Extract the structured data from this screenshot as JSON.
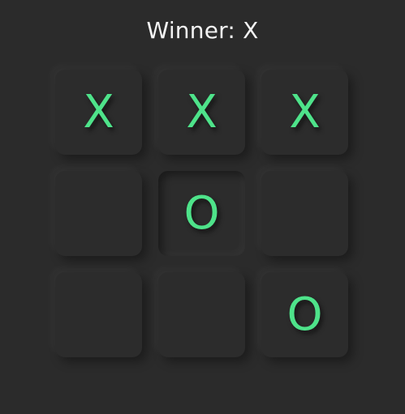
{
  "status": {
    "text": "Winner: X"
  },
  "colors": {
    "background": "#2b2b2b",
    "mark": "#4ee38a",
    "text": "#f3f3f3"
  },
  "board": {
    "cells": [
      {
        "mark": "X",
        "pressed": false
      },
      {
        "mark": "X",
        "pressed": false
      },
      {
        "mark": "X",
        "pressed": false
      },
      {
        "mark": "",
        "pressed": false
      },
      {
        "mark": "O",
        "pressed": true
      },
      {
        "mark": "",
        "pressed": false
      },
      {
        "mark": "",
        "pressed": false
      },
      {
        "mark": "",
        "pressed": false
      },
      {
        "mark": "O",
        "pressed": false
      }
    ]
  }
}
